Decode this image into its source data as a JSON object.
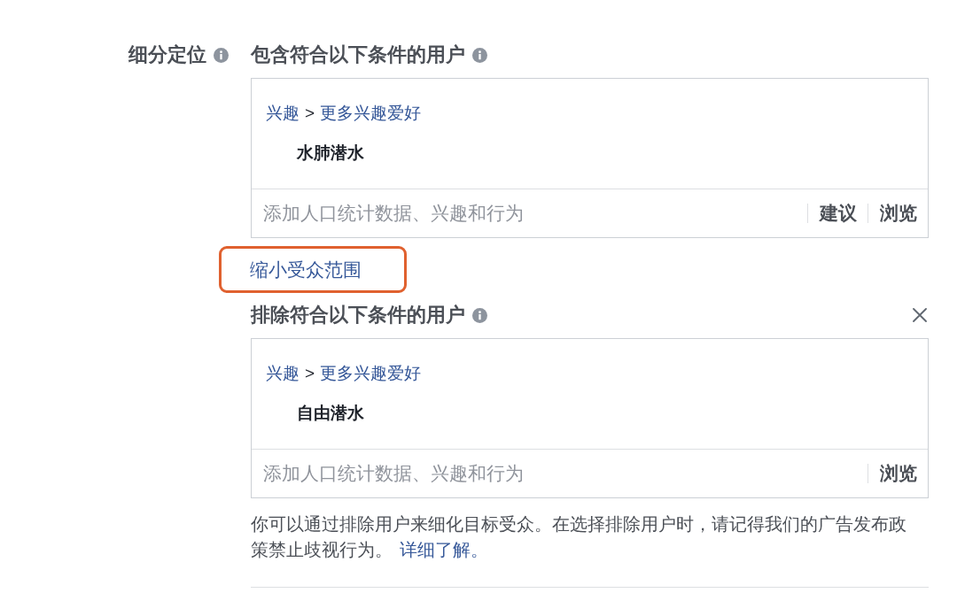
{
  "targeting": {
    "label": "细分定位"
  },
  "include_section": {
    "title": "包含符合以下条件的用户",
    "path": {
      "items": [
        "兴趣",
        "更多兴趣爱好"
      ],
      "separator": ">"
    },
    "selections": [
      "水肺潜水"
    ],
    "input": {
      "placeholder": "添加人口统计数据、兴趣和行为"
    },
    "actions": [
      "建议",
      "浏览"
    ]
  },
  "narrow_link": {
    "label": "缩小受众范围",
    "highlighted": true
  },
  "exclude_section": {
    "title": "排除符合以下条件的用户",
    "closable": true,
    "path": {
      "items": [
        "兴趣",
        "更多兴趣爱好"
      ],
      "separator": ">"
    },
    "selections": [
      "自由潜水"
    ],
    "input": {
      "placeholder": "添加人口统计数据、兴趣和行为"
    },
    "actions": [
      "浏览"
    ]
  },
  "help": {
    "text": "你可以通过排除用户来细化目标受众。在选择排除用户时，请记得我们的广告发布政策禁止歧视行为。",
    "link": "详细了解。"
  }
}
